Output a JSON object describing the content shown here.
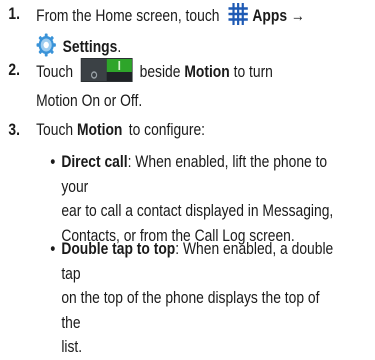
{
  "steps": [
    {
      "number": "1.",
      "prefix": "From the Home screen, touch",
      "apps_label": "Apps",
      "arrow": "→",
      "settings_label": "Settings",
      "end": "."
    },
    {
      "number": "2.",
      "touch": "Touch",
      "beside": "beside",
      "motion_label": "Motion",
      "suffix": "to turn",
      "line2": "Motion On or Off."
    },
    {
      "number": "3.",
      "touch": "Touch",
      "motion_label": "Motion",
      "suffix": "to configure:"
    }
  ],
  "options": [
    {
      "bullet": "•",
      "title": "Direct call",
      "lines": [
        ": When enabled, lift the phone to your",
        "ear to call a contact displayed in Messaging,",
        "Contacts, or from the Call Log screen."
      ]
    },
    {
      "bullet": "•",
      "title": "Double tap to top",
      "lines": [
        ": When enabled, a double tap",
        "on the top of the phone displays the top of the",
        "list."
      ]
    }
  ],
  "icons": {
    "apps": "apps-grid-icon",
    "settings": "settings-gear-icon",
    "toggle": "motion-toggle-switch-icon"
  },
  "colors": {
    "apps_icon": "#1e5ab4",
    "settings_icon": "#3a93d8",
    "toggle_on": "#2ea52a",
    "toggle_dark": "#2b3033"
  }
}
